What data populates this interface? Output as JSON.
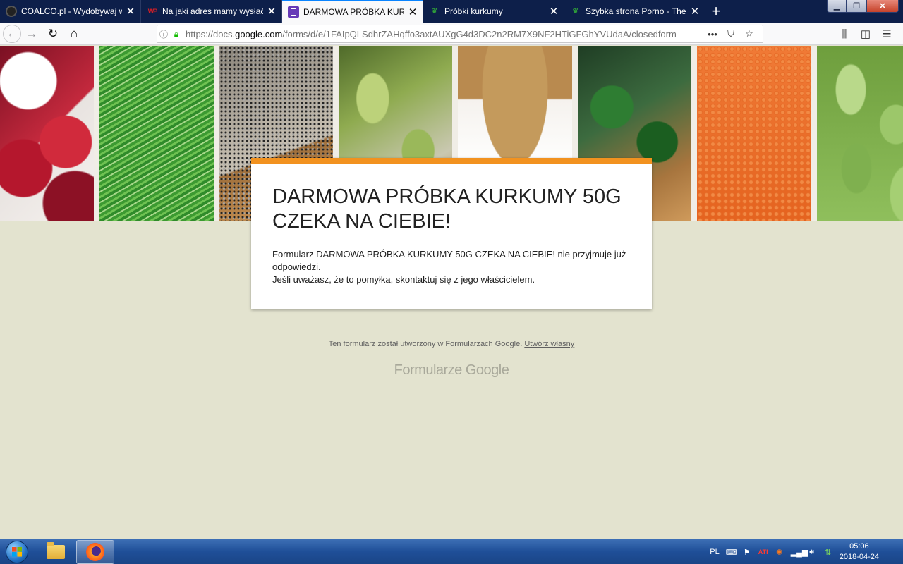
{
  "browser": {
    "tabs": [
      {
        "title": "COALCO.pl - Wydobywaj wirtu",
        "favicon": "coalco-icon",
        "active": false
      },
      {
        "title": "Na jaki adres mamy wysłać Tw",
        "favicon": "wp-icon",
        "active": false
      },
      {
        "title": "DARMOWA PRÓBKA KURKUMY",
        "favicon": "google-forms-icon",
        "active": true
      },
      {
        "title": "Próbki kurkumy",
        "favicon": "leaf-icon",
        "active": false
      },
      {
        "title": "Szybka strona Porno - Theme",
        "favicon": "leaf-icon",
        "active": false
      }
    ],
    "url_prefix": "https://docs.",
    "url_host": "google.com",
    "url_path": "/forms/d/e/1FAIpQLSdhrZAHqffo3axtAUXgG4d3DC2n2RM7X9NF2HTiGFGhYVUdaA/closedform"
  },
  "form": {
    "title": "DARMOWA PRÓBKA KURKUMY 50G CZEKA NA CIEBIE!",
    "message_line1": "Formularz DARMOWA PRÓBKA KURKUMY 50G CZEKA NA CIEBIE! nie przyjmuje już odpowiedzi.",
    "message_line2": "Jeśli uważasz, że to pomyłka, skontaktuj się z jego właścicielem.",
    "accent_color": "#f2921f"
  },
  "footer": {
    "note": "Ten formularz został utworzony w Formularzach Google.",
    "create_link": "Utwórz własny",
    "logo_text": "Formularze Google"
  },
  "taskbar": {
    "language": "PL",
    "time": "05:06",
    "date": "2018-04-24"
  }
}
